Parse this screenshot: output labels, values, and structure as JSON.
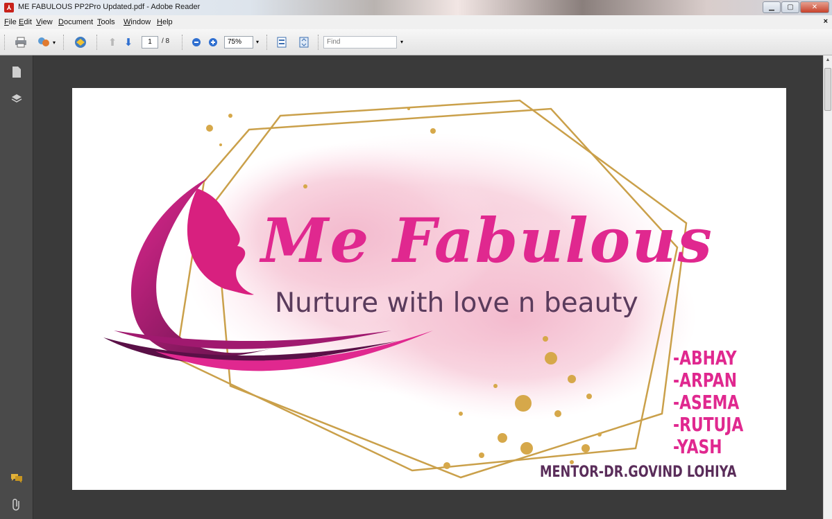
{
  "window": {
    "title": "ME FABULOUS PP2Pro Updated.pdf - Adobe Reader",
    "icon": "pdf-icon",
    "controls": [
      "minimize",
      "maximize",
      "close"
    ]
  },
  "menu": {
    "items": [
      "File",
      "Edit",
      "View",
      "Document",
      "Tools",
      "Window",
      "Help"
    ]
  },
  "toolbar": {
    "current_page": "1",
    "total_pages": "/ 8",
    "zoom": "75%",
    "find_placeholder": "Find"
  },
  "document": {
    "brand": "Me Fabulous",
    "tagline": "Nurture with love n beauty",
    "team": [
      "-ABHAY",
      "-ARPAN",
      "-ASEMA",
      "-RUTUJA",
      "-YASH"
    ],
    "mentor": "MENTOR-DR.GOVIND LOHIYA"
  },
  "colors": {
    "brand_pink": "#e0288f",
    "tagline_purple": "#5a3b5c",
    "gold": "#c99a3b",
    "watercolor": "#f6c6d6"
  }
}
